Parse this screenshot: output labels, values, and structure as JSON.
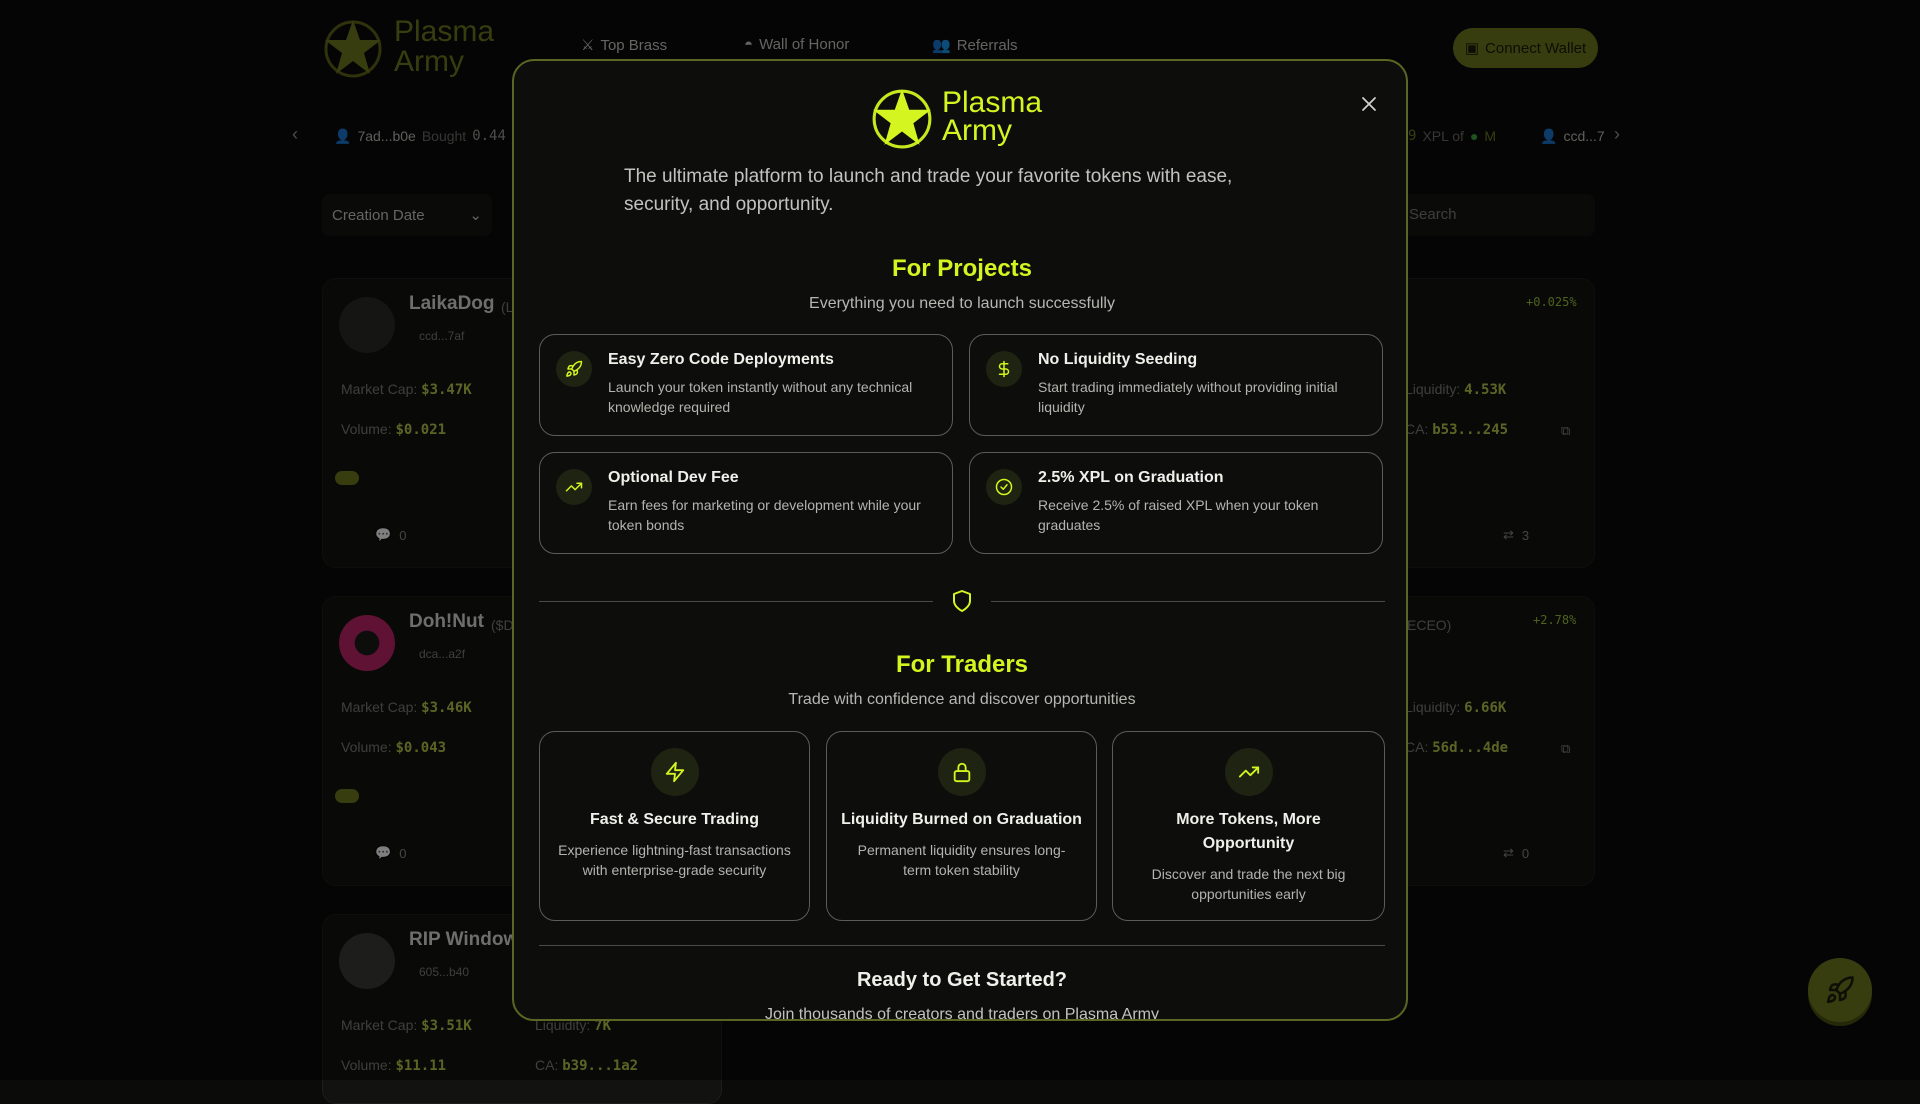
{
  "brand": {
    "line1": "Plasma",
    "line2": "Army",
    "accent": "#d4f51f",
    "star_icon": "star-icon"
  },
  "nav": {
    "items": [
      {
        "label": "Top Brass",
        "icon": "swords-icon"
      },
      {
        "label": "Wall of Honor",
        "icon": "helmet-icon"
      },
      {
        "label": "Referrals",
        "icon": "users-icon"
      }
    ],
    "connect_label": "Connect Wallet"
  },
  "ticker": {
    "left": {
      "user": "7ad...b0e",
      "action": "Bought",
      "amount": "0.44"
    },
    "right": {
      "amount": "9",
      "text": "XPL of",
      "token": "M"
    },
    "far_right": {
      "user": "ccd...7"
    }
  },
  "filters": {
    "sort_label": "Creation Date",
    "search_placeholder": "Search"
  },
  "cards": [
    {
      "name": "LaikaDog",
      "ticker_hint": "(L",
      "creator": "ccd...7af",
      "market_cap": "$3.47K",
      "volume": "$0.021",
      "liquidity": "4.53K",
      "ca": "b53...245",
      "change": "+0.025%",
      "comments": "0",
      "trades": "3"
    },
    {
      "name": "Doh!Nut",
      "ticker_hint": "($D",
      "creator": "dca...a2f",
      "market_cap": "$3.46K",
      "volume": "$0.043",
      "liquidity": "6.66K",
      "ca": "56d...4de",
      "change": "+2.78%",
      "comments": "0",
      "trades": "0",
      "right_hint": "ECEO)"
    },
    {
      "name": "RIP Windows",
      "creator": "605...b40",
      "market_cap": "$3.51K",
      "volume": "$11.11",
      "liquidity": "7K",
      "ca": "b39...1a2"
    }
  ],
  "labels": {
    "market_cap": "Market Cap:",
    "volume": "Volume:",
    "liquidity": "Liquidity:",
    "ca": "CA:"
  },
  "modal": {
    "tagline": "The ultimate platform to launch and trade your favorite tokens with ease, security, and opportunity.",
    "projects": {
      "title": "For Projects",
      "subtitle": "Everything you need to launch successfully",
      "features": [
        {
          "icon": "rocket-icon",
          "title": "Easy Zero Code Deployments",
          "desc": "Launch your token instantly without any technical knowledge required"
        },
        {
          "icon": "dollar-icon",
          "title": "No Liquidity Seeding",
          "desc": "Start trading immediately without providing initial liquidity"
        },
        {
          "icon": "trending-up-icon",
          "title": "Optional Dev Fee",
          "desc": "Earn fees for marketing or development while your token bonds"
        },
        {
          "icon": "check-circle-icon",
          "title": "2.5% XPL on Graduation",
          "desc": "Receive 2.5% of raised XPL when your token graduates"
        }
      ]
    },
    "traders": {
      "title": "For Traders",
      "subtitle": "Trade with confidence and discover opportunities",
      "features": [
        {
          "icon": "lightning-icon",
          "title": "Fast & Secure Trading",
          "desc": "Experience lightning-fast transactions with enterprise-grade security"
        },
        {
          "icon": "lock-icon",
          "title": "Liquidity Burned on Graduation",
          "desc": "Permanent liquidity ensures long-term token stability"
        },
        {
          "icon": "trending-up-icon",
          "title": "More Tokens, More Opportunity",
          "desc": "Discover and trade the next big opportunities early"
        }
      ]
    },
    "cta_title": "Ready to Get Started?",
    "cta_text": "Join thousands of creators and traders on Plasma Army"
  }
}
